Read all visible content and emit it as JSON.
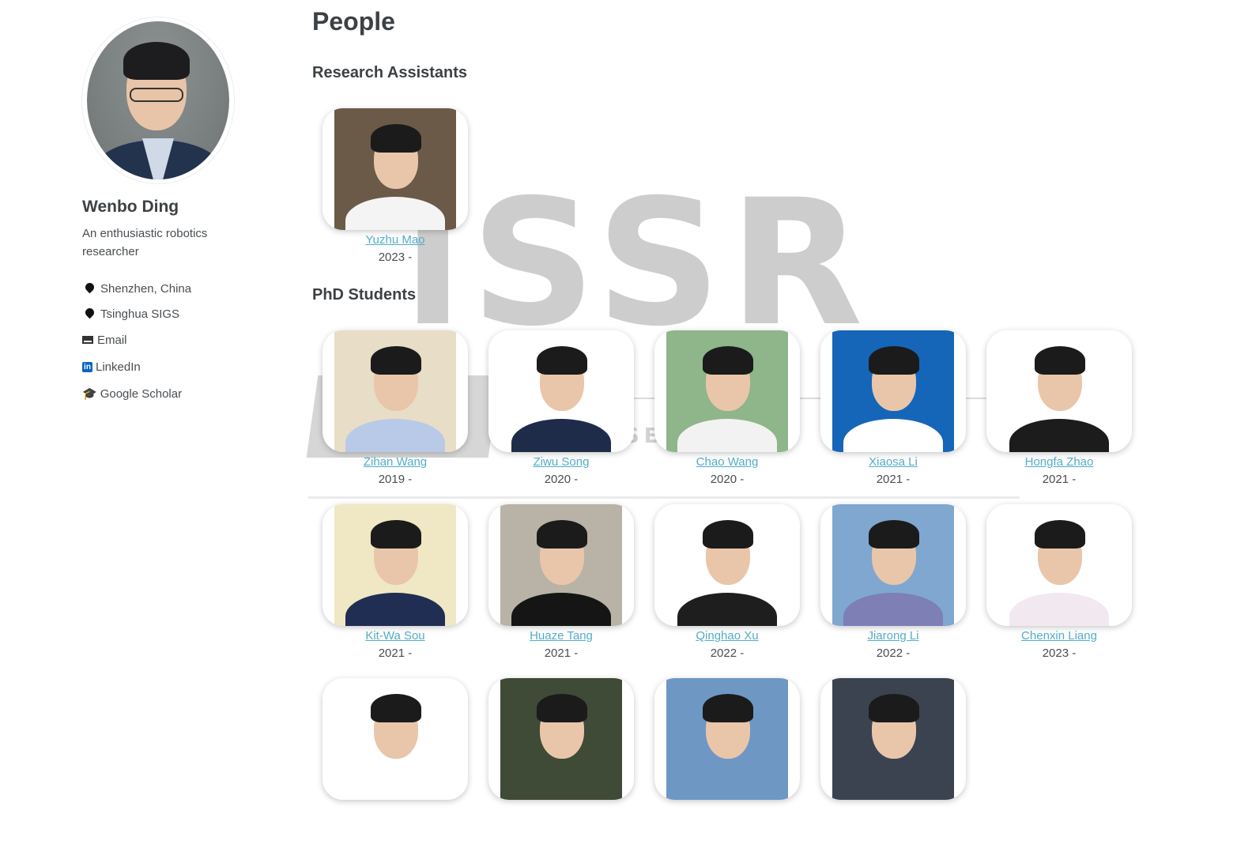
{
  "watermark": {
    "big_text": "iSSR",
    "small_text": "SE              ND             S G"
  },
  "profile": {
    "name": "Wenbo Ding",
    "bio": "An enthusiastic robotics researcher",
    "location": "Shenzhen, China",
    "affiliation": "Tsinghua SIGS",
    "email_label": "Email",
    "linkedin_label": "LinkedIn",
    "scholar_label": "Google Scholar"
  },
  "page": {
    "title": "People",
    "section_ra": "Research Assistants",
    "section_phd": "PhD Students"
  },
  "research_assistants": [
    {
      "name": "Yuzhu Mao",
      "year": "2023 -",
      "bg": "#6b5a48",
      "body": "#f4f4f4"
    }
  ],
  "phd_students": [
    {
      "name": "Zihan Wang",
      "year": "2019 -",
      "bg": "#e8ddc6",
      "body": "#b9c9e8"
    },
    {
      "name": "Ziwu Song",
      "year": "2020 -",
      "bg": "#ffffff",
      "body": "#1e2c4a"
    },
    {
      "name": "Chao Wang",
      "year": "2020 -",
      "bg": "#8fb58a",
      "body": "#f2f2f2"
    },
    {
      "name": "Xiaosa Li",
      "year": "2021 -",
      "bg": "#1566b8",
      "body": "#ffffff"
    },
    {
      "name": "Hongfa Zhao",
      "year": "2021 -",
      "bg": "#ffffff",
      "body": "#1c1c1c"
    },
    {
      "name": "Kit-Wa Sou",
      "year": "2021 -",
      "bg": "#f0e7c4",
      "body": "#1f2e52"
    },
    {
      "name": "Huaze Tang",
      "year": "2021 -",
      "bg": "#b9b2a7",
      "body": "#151515"
    },
    {
      "name": "Qinghao Xu",
      "year": "2022 -",
      "bg": "#ffffff",
      "body": "#1e1e1e"
    },
    {
      "name": "Jiarong Li",
      "year": "2022 -",
      "bg": "#7fa7cf",
      "body": "#7d7fb5"
    },
    {
      "name": "Chenxin Liang",
      "year": "2023 -",
      "bg": "#ffffff",
      "body": "#f1e8f0"
    },
    {
      "name": "",
      "year": "",
      "bg": "#ffffff",
      "body": "#ffffff"
    },
    {
      "name": "",
      "year": "",
      "bg": "#3f4a37",
      "body": "#3f4a37"
    },
    {
      "name": "",
      "year": "",
      "bg": "#6f97c4",
      "body": "#6f97c4"
    },
    {
      "name": "",
      "year": "",
      "bg": "#3b4350",
      "body": "#3b4350"
    }
  ]
}
